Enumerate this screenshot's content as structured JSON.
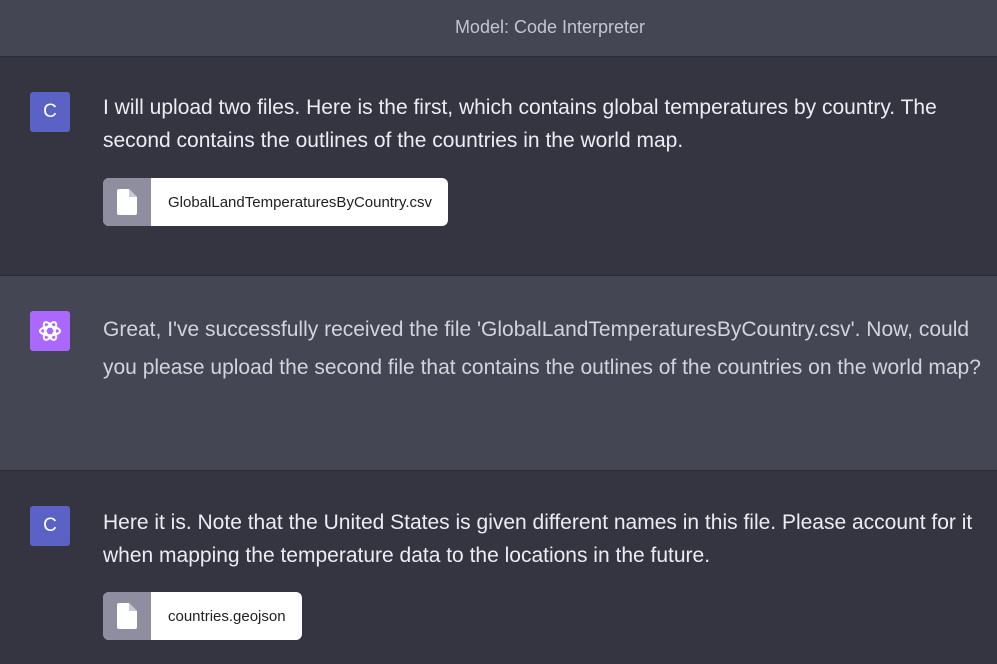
{
  "header": {
    "model_label": "Model: Code Interpreter"
  },
  "messages": [
    {
      "role": "user",
      "avatar_letter": "C",
      "text": "I will upload two files. Here is the first, which contains global temperatures by country. The second contains the outlines of the countries in the world map.",
      "attachment": "GlobalLandTemperaturesByCountry.csv"
    },
    {
      "role": "assistant",
      "text": "Great, I've successfully received the file 'GlobalLandTemperaturesByCountry.csv'. Now, could you please upload the second file that contains the outlines of the countries on the world map?"
    },
    {
      "role": "user",
      "avatar_letter": "C",
      "text": "Here it is. Note that the United States is given different names in this file. Please account for it when mapping the temperature data to the locations in the future.",
      "attachment": "countries.geojson"
    }
  ],
  "colors": {
    "user_avatar": "#5a63c5",
    "assistant_avatar": "#ab68ff",
    "user_bg": "#343541",
    "assistant_bg": "#444654"
  },
  "icons": {
    "assistant_avatar": "openai-logo-icon",
    "attachment": "file-icon"
  }
}
